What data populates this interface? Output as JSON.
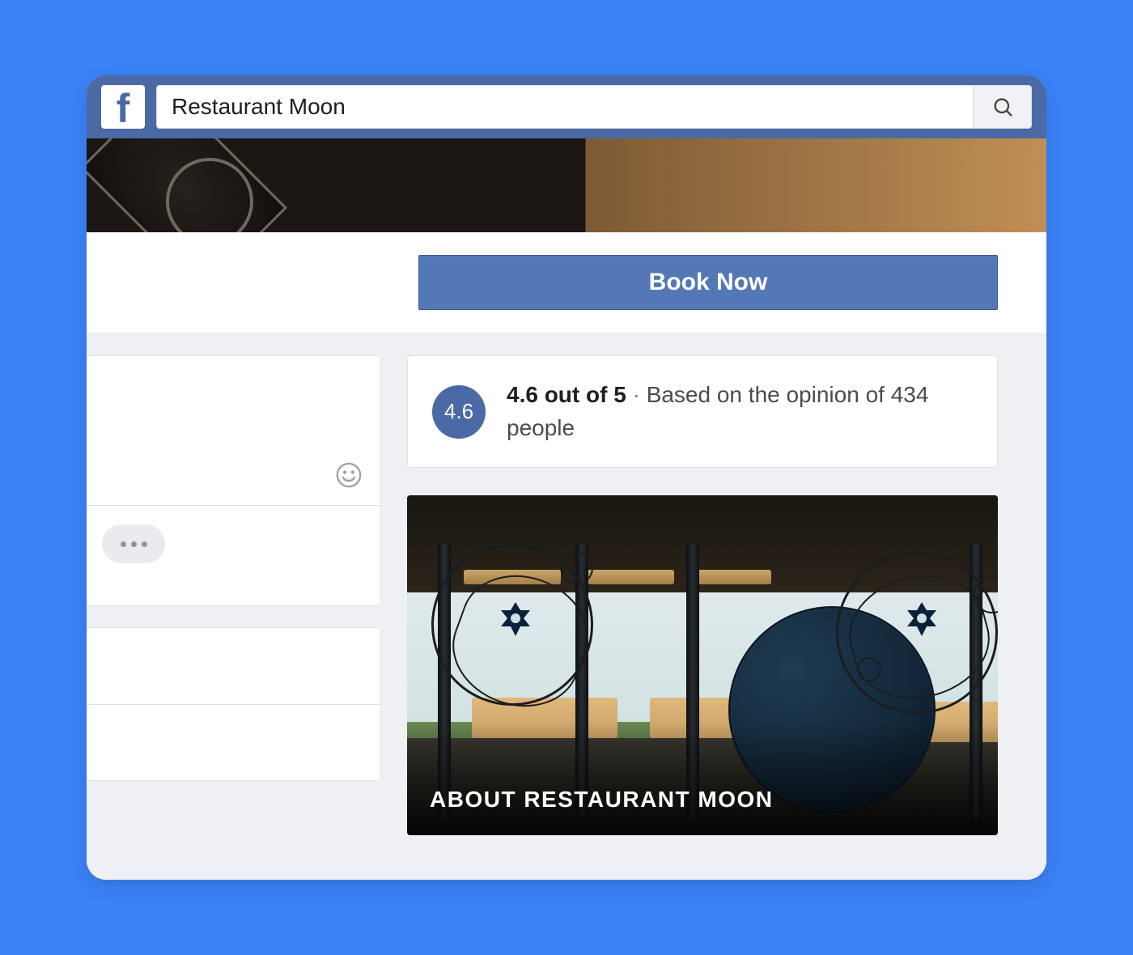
{
  "header": {
    "search_value": "Restaurant Moon"
  },
  "cta": {
    "book_now_label": "Book Now"
  },
  "rating": {
    "badge_value": "4.6",
    "score_text": "4.6 out of 5",
    "separator": " · ",
    "detail_text": "Based on the opinion of 434 people"
  },
  "about": {
    "title": "ABOUT RESTAURANT MOON"
  }
}
